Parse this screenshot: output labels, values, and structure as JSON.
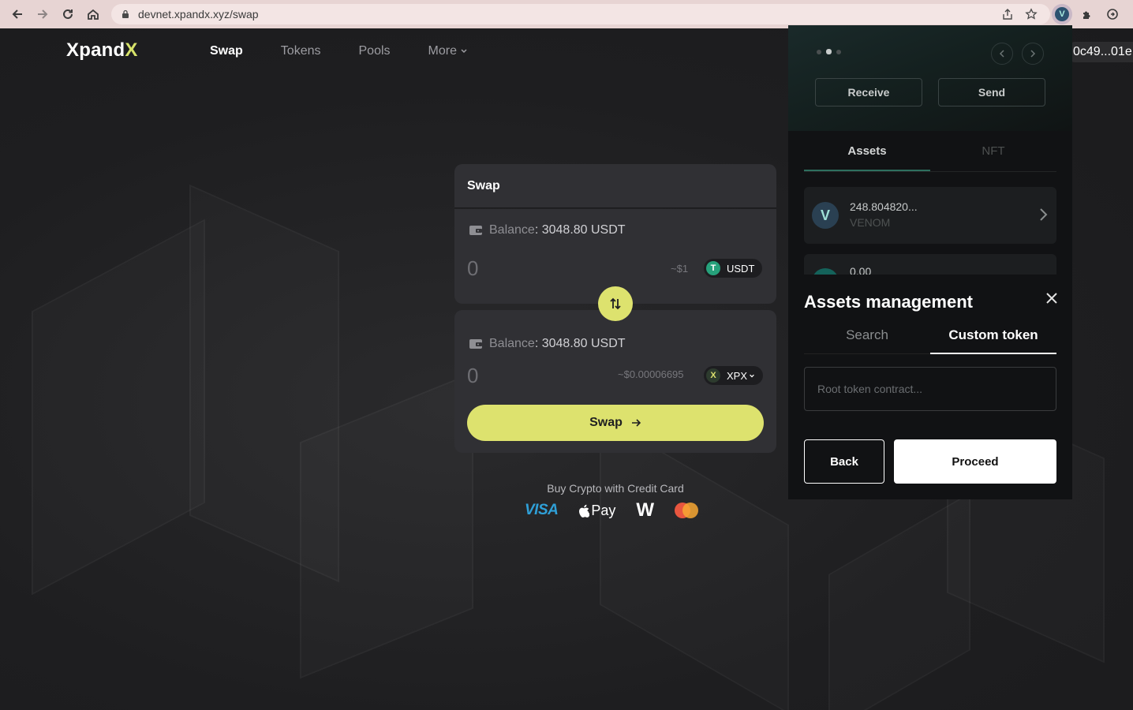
{
  "browser": {
    "url": "devnet.xpandx.xyz/swap"
  },
  "header": {
    "logo_text": "Xpand",
    "logo_accent": "X",
    "nav": [
      {
        "label": "Swap"
      },
      {
        "label": "Tokens"
      },
      {
        "label": "Pools"
      },
      {
        "label": "More"
      }
    ],
    "address": "0c49...01e"
  },
  "swap": {
    "title": "Swap",
    "from": {
      "balance_label": "Balance",
      "balance_value": ": 3048.80 USDT",
      "amount": "0",
      "usd": "~$1",
      "token": "USDT"
    },
    "to": {
      "balance_label": "Balance",
      "balance_value": ": 3048.80 USDT",
      "amount": "0",
      "usd": "~$0.00006695",
      "token": "XPX"
    },
    "button_label": "Swap"
  },
  "buy_crypto": {
    "text": "Buy Crypto with Credit Card",
    "logos": [
      "VISA",
      "Pay",
      "W"
    ]
  },
  "wallet_popup": {
    "receive_label": "Receive",
    "send_label": "Send",
    "tabs": [
      {
        "label": "Assets"
      },
      {
        "label": "NFT"
      }
    ],
    "assets": [
      {
        "amount": "248.804820...",
        "symbol": "VENOM"
      },
      {
        "amount": "0.00"
      }
    ]
  },
  "assets_management": {
    "title": "Assets management",
    "tabs": [
      {
        "label": "Search"
      },
      {
        "label": "Custom token"
      }
    ],
    "input_placeholder": "Root token contract...",
    "back_label": "Back",
    "proceed_label": "Proceed"
  },
  "colors": {
    "accent": "#dde26e",
    "background": "#1f1f21",
    "card": "#303034",
    "usdt": "#26a17b"
  },
  "icons": [
    "back-icon",
    "forward-icon",
    "reload-icon",
    "home-icon",
    "lock-icon",
    "share-icon",
    "star-icon",
    "venom-extension-icon",
    "puzzle-icon",
    "sync-icon",
    "wallet-icon",
    "swap-arrows-icon",
    "arrow-right-icon",
    "close-icon",
    "chevron-right-icon",
    "chevron-left-icon",
    "chevron-down-icon"
  ]
}
